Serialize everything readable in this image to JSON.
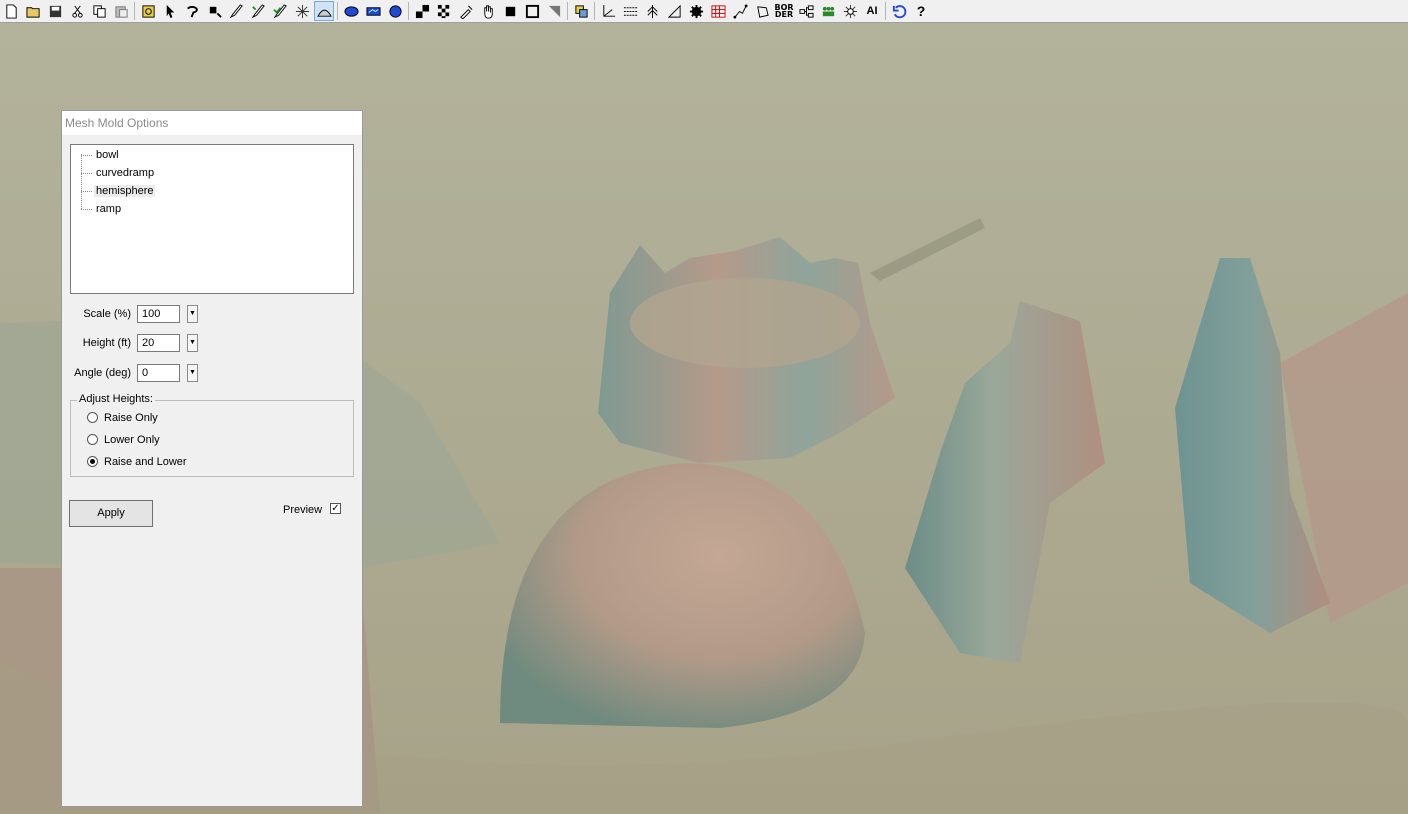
{
  "toolbar": {
    "icons": [
      "new-file-icon",
      "open-folder-icon",
      "save-icon",
      "cut-icon",
      "copy-icon",
      "paste-icon",
      "terrain-select-icon",
      "pointer-icon",
      "lasso-icon",
      "magic-select-icon",
      "paint-tool-icon",
      "paint-tool-2-icon",
      "paint-tool-3-icon",
      "starburst-icon",
      "mesh-mold-icon",
      "blue-blob-icon",
      "blue-rect-icon",
      "blue-blob-2-icon",
      "pattern-icon",
      "checker-icon",
      "eyedropper-icon",
      "hand-icon",
      "square-fill-icon",
      "square-outline-icon",
      "gradient-icon",
      "copy-layers-icon",
      "axes-icon",
      "lines-icon",
      "tree-icon",
      "angle-icon",
      "gear-icon",
      "grid-image-icon",
      "path-icon",
      "polygon-icon",
      "hierarchy-icon",
      "units-icon",
      "rotate-icon",
      "undo-history-icon",
      "help-icon"
    ],
    "border_label": [
      "BOR",
      "DER"
    ],
    "ai_label": "AI"
  },
  "panel": {
    "title": "Mesh Mold Options",
    "molds": [
      "bowl",
      "curvedramp",
      "hemisphere",
      "ramp"
    ],
    "selected_mold": "hemisphere",
    "scale_label": "Scale (%)",
    "scale_value": "100",
    "height_label": "Height (ft)",
    "height_value": "20",
    "angle_label": "Angle (deg)",
    "angle_value": "0",
    "adjust_title": "Adjust Heights:",
    "adjust_options": [
      "Raise Only",
      "Lower Only",
      "Raise and Lower"
    ],
    "adjust_selected": "Raise and Lower",
    "apply_label": "Apply",
    "preview_label": "Preview",
    "preview_checked": true
  },
  "colors": {
    "ground": "#a9a88f",
    "terrain_pink": "#b6988a",
    "terrain_teal": "#6f8e88",
    "panel_bg": "#f0f0f0"
  }
}
